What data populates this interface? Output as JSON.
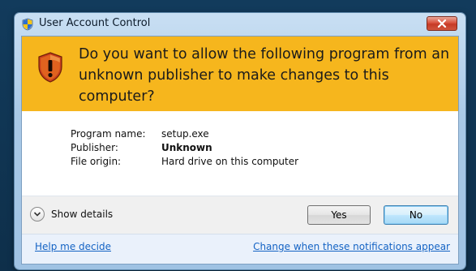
{
  "window": {
    "title": "User Account Control"
  },
  "banner": {
    "line1": "Do you want to allow the following program from an",
    "line2": "unknown publisher to make changes to this computer?"
  },
  "info": {
    "rows": [
      {
        "label": "Program name:",
        "value": "setup.exe"
      },
      {
        "label": "Publisher:",
        "value": "Unknown"
      },
      {
        "label": "File origin:",
        "value": "Hard drive on this computer"
      }
    ]
  },
  "actions": {
    "details_label": "Show details",
    "yes_label": "Yes",
    "no_label": "No"
  },
  "links": {
    "help": "Help me decide",
    "change": "Change when these notifications appear"
  },
  "colors": {
    "banner": "#f6b61d",
    "link": "#1463c4",
    "close_button": "#d9533f"
  },
  "icons": {
    "title": "uac-shield-icon",
    "banner": "warning-shield-icon",
    "close": "close-icon",
    "details": "chevron-down-icon"
  }
}
